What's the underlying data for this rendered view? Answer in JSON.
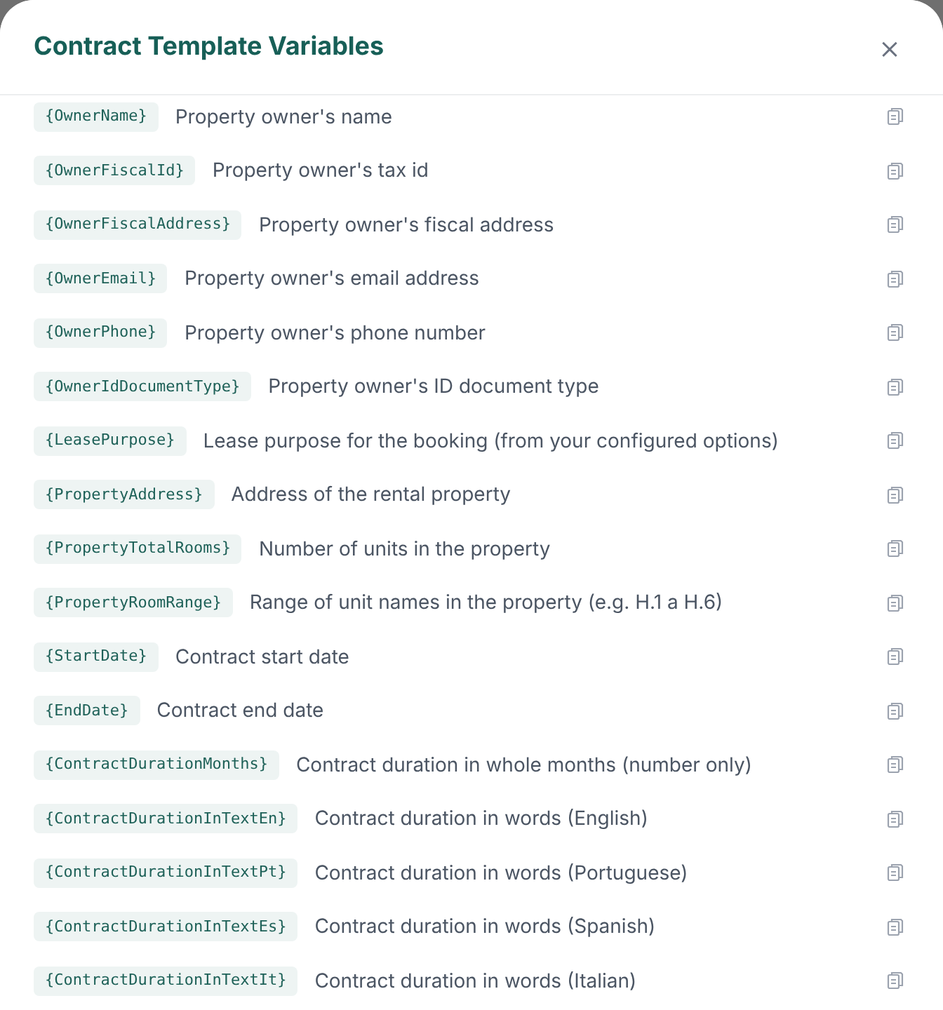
{
  "dialog": {
    "title": "Contract Template Variables",
    "close": "×"
  },
  "variables": [
    {
      "name": "{OwnerName}",
      "description": "Property owner's name"
    },
    {
      "name": "{OwnerFiscalId}",
      "description": "Property owner's tax id"
    },
    {
      "name": "{OwnerFiscalAddress}",
      "description": "Property owner's fiscal address"
    },
    {
      "name": "{OwnerEmail}",
      "description": "Property owner's email address"
    },
    {
      "name": "{OwnerPhone}",
      "description": "Property owner's phone number"
    },
    {
      "name": "{OwnerIdDocumentType}",
      "description": "Property owner's ID document type"
    },
    {
      "name": "{LeasePurpose}",
      "description": "Lease purpose for the booking (from your configured options)"
    },
    {
      "name": "{PropertyAddress}",
      "description": "Address of the rental property"
    },
    {
      "name": "{PropertyTotalRooms}",
      "description": "Number of units in the property"
    },
    {
      "name": "{PropertyRoomRange}",
      "description": "Range of unit names in the property (e.g. H.1 a H.6)"
    },
    {
      "name": "{StartDate}",
      "description": "Contract start date"
    },
    {
      "name": "{EndDate}",
      "description": "Contract end date"
    },
    {
      "name": "{ContractDurationMonths}",
      "description": "Contract duration in whole months (number only)"
    },
    {
      "name": "{ContractDurationInTextEn}",
      "description": "Contract duration in words (English)"
    },
    {
      "name": "{ContractDurationInTextPt}",
      "description": "Contract duration in words (Portuguese)"
    },
    {
      "name": "{ContractDurationInTextEs}",
      "description": "Contract duration in words (Spanish)"
    },
    {
      "name": "{ContractDurationInTextIt}",
      "description": "Contract duration in words (Italian)"
    }
  ]
}
